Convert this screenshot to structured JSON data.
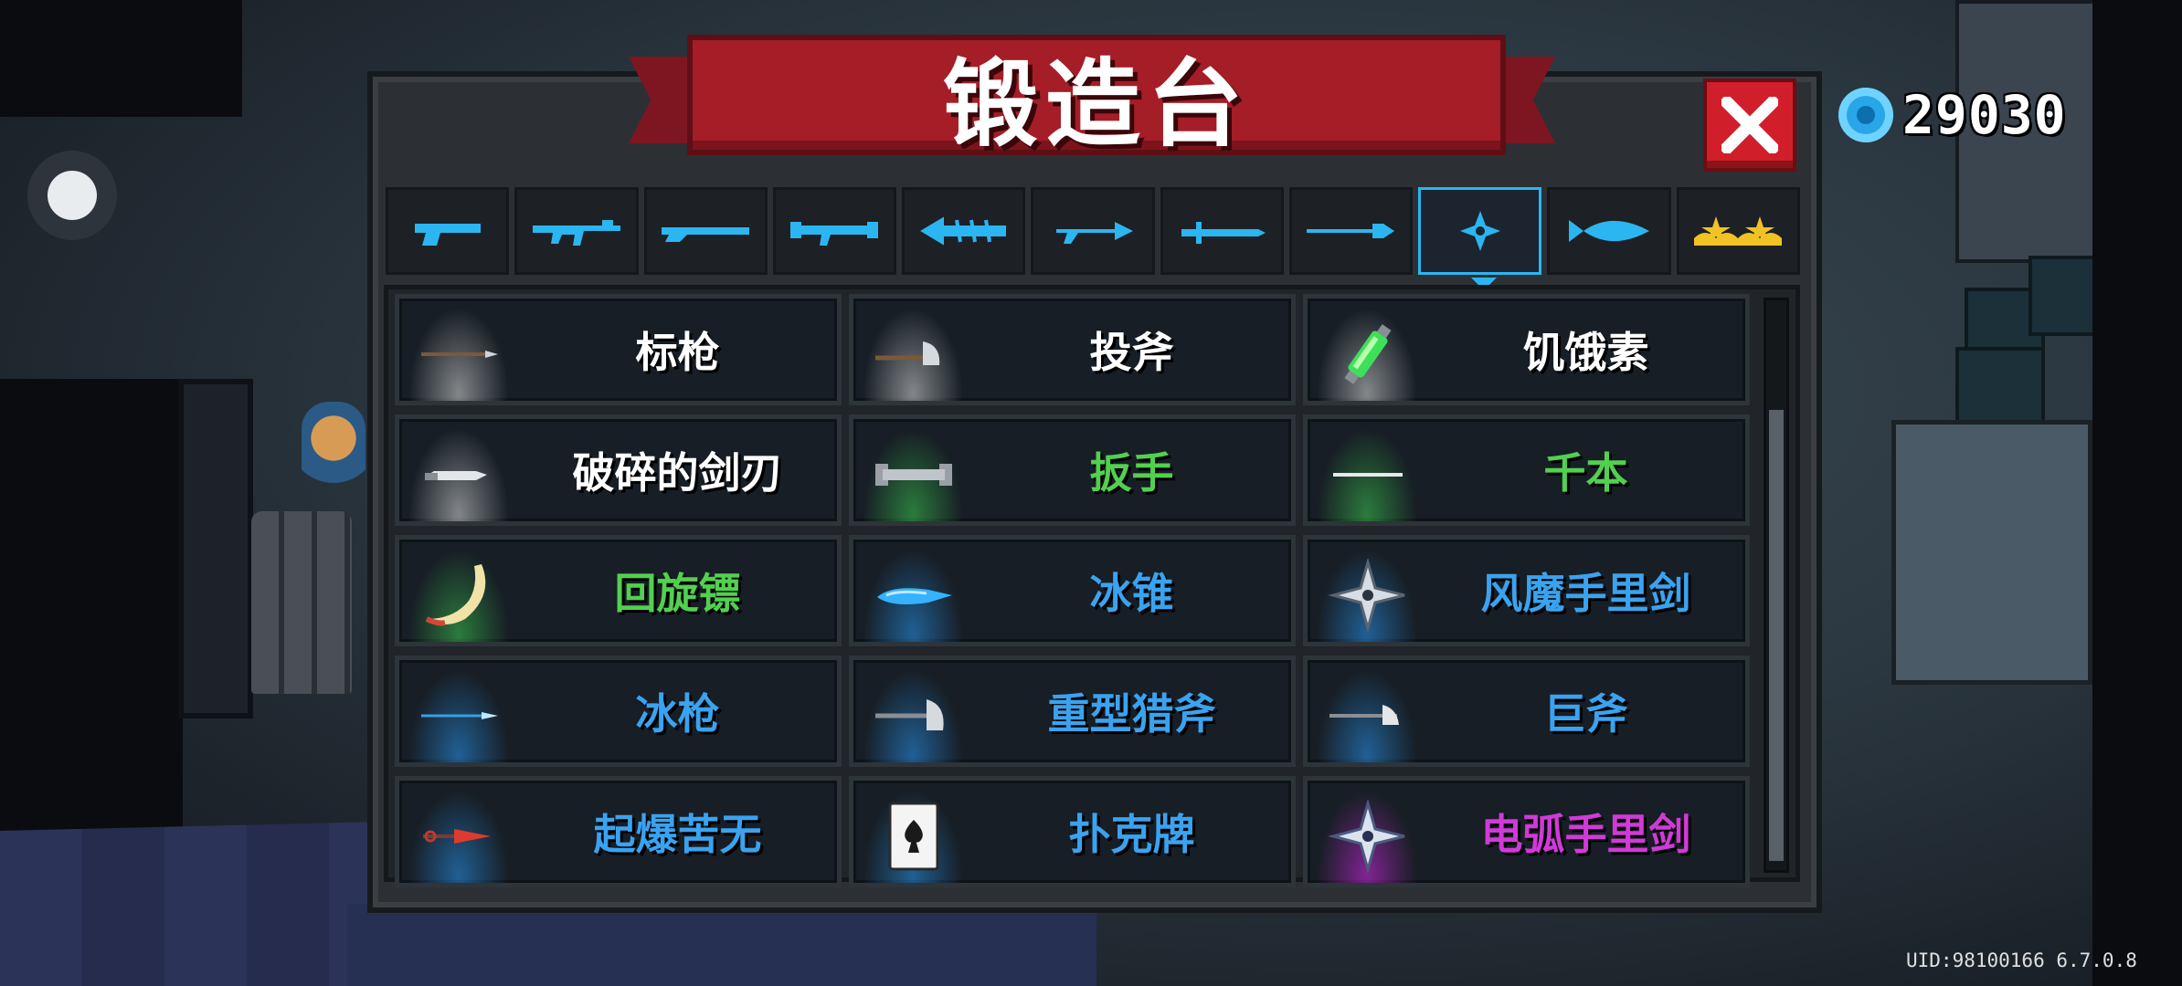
{
  "title": "锻造台",
  "gems": "29030",
  "uid": "UID:98100166 6.7.0.8",
  "colors": {
    "accent_blue": "#2bb6f2",
    "tier_white": "#ffffff",
    "tier_green": "#52d04f",
    "tier_blue": "#3aa3f0",
    "tier_purple": "#d03ad8",
    "banner_red": "#a41d27"
  },
  "tabs": [
    {
      "icon": "pistol-icon"
    },
    {
      "icon": "assault-rifle-icon"
    },
    {
      "icon": "shotgun-icon"
    },
    {
      "icon": "rocket-launcher-icon"
    },
    {
      "icon": "fish-bone-gun-icon"
    },
    {
      "icon": "bow-icon"
    },
    {
      "icon": "sword-icon"
    },
    {
      "icon": "spear-icon"
    },
    {
      "icon": "shuriken-icon",
      "active": true
    },
    {
      "icon": "fish-icon"
    },
    {
      "icon": "crown-icon"
    }
  ],
  "items": [
    {
      "name": "标枪",
      "icon": "javelin-icon",
      "tier": "white"
    },
    {
      "name": "投斧",
      "icon": "throwing-axe-icon",
      "tier": "white"
    },
    {
      "name": "饥饿素",
      "icon": "green-syringe-icon",
      "tier": "white"
    },
    {
      "name": "破碎的剑刃",
      "icon": "broken-blade-icon",
      "tier": "white"
    },
    {
      "name": "扳手",
      "icon": "wrench-icon",
      "tier": "green"
    },
    {
      "name": "千本",
      "icon": "senbon-icon",
      "tier": "green"
    },
    {
      "name": "回旋镖",
      "icon": "boomerang-icon",
      "tier": "green"
    },
    {
      "name": "冰锥",
      "icon": "ice-cone-icon",
      "tier": "blue"
    },
    {
      "name": "风魔手里剑",
      "icon": "fuma-shuriken-icon",
      "tier": "blue"
    },
    {
      "name": "冰枪",
      "icon": "ice-spear-icon",
      "tier": "blue"
    },
    {
      "name": "重型猎斧",
      "icon": "heavy-hunting-axe-icon",
      "tier": "blue"
    },
    {
      "name": "巨斧",
      "icon": "giant-axe-icon",
      "tier": "blue"
    },
    {
      "name": "起爆苦无",
      "icon": "explosive-kunai-icon",
      "tier": "blue"
    },
    {
      "name": "扑克牌",
      "icon": "poker-card-icon",
      "tier": "blue"
    },
    {
      "name": "电弧手里剑",
      "icon": "arc-shuriken-icon",
      "tier": "purple"
    }
  ]
}
